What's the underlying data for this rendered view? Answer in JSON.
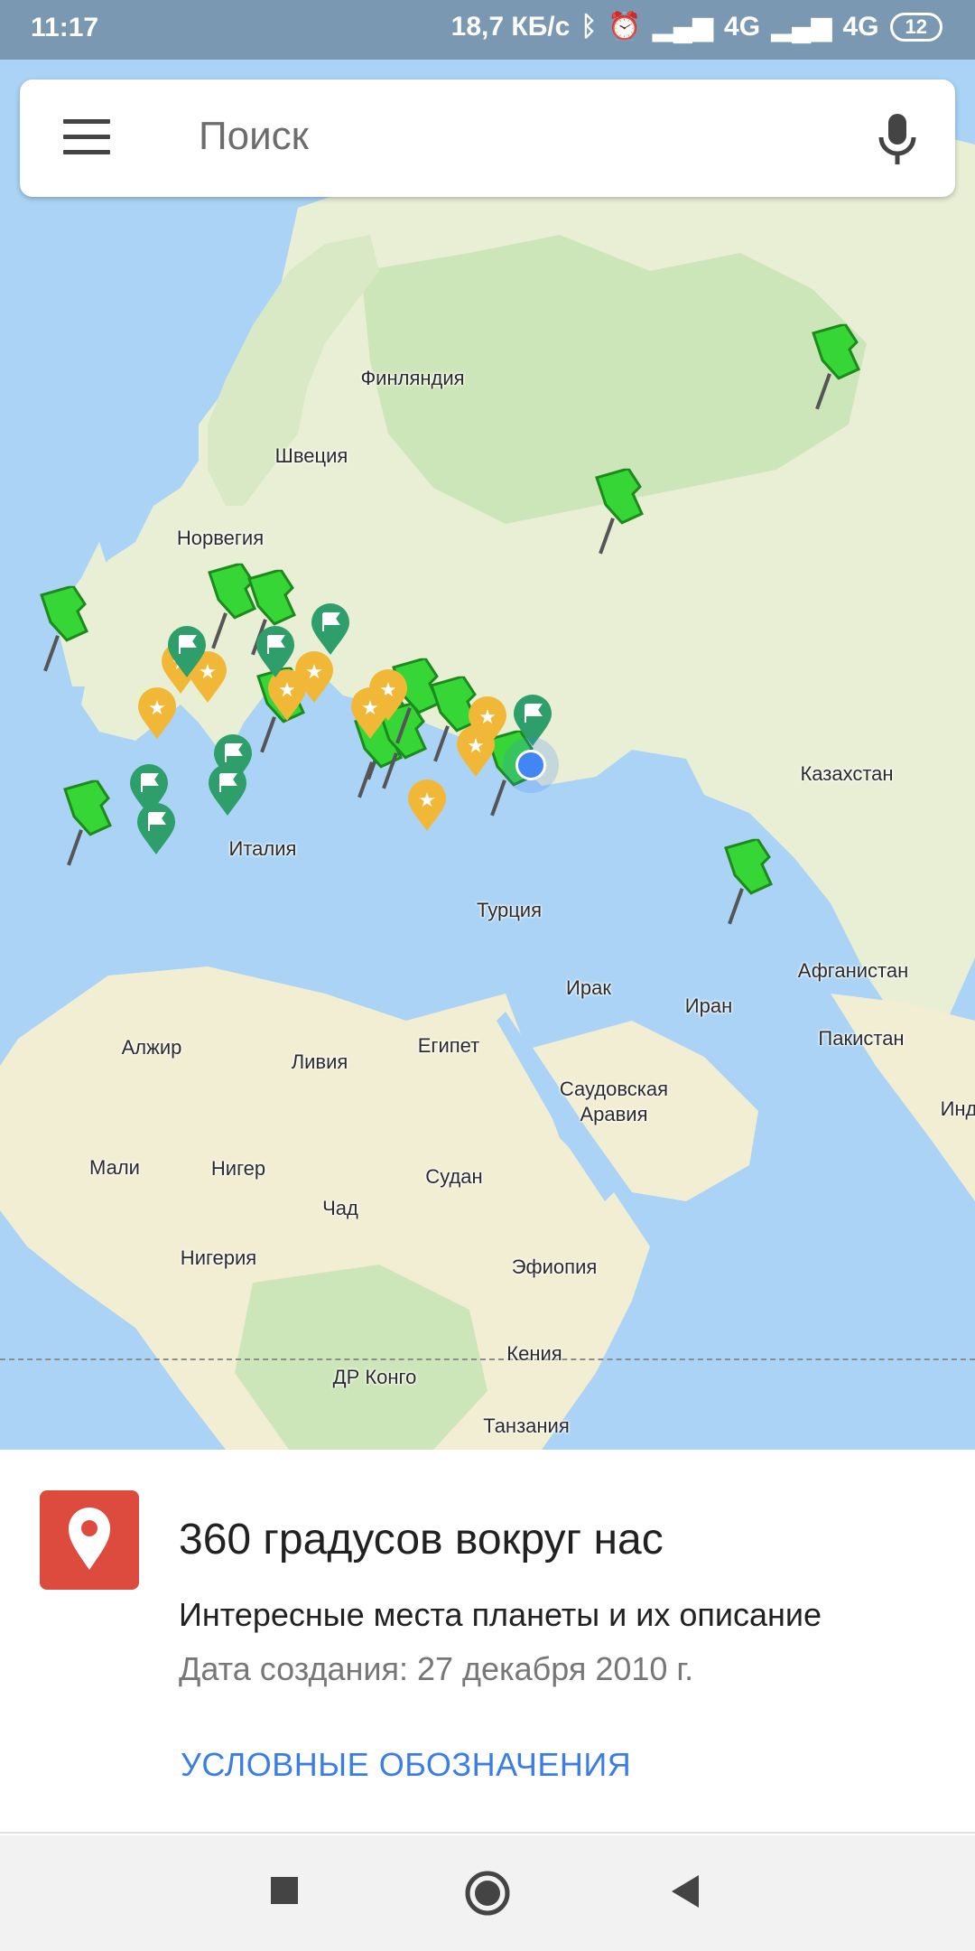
{
  "status_bar": {
    "time": "11:17",
    "speed": "18,7 КБ/с",
    "network1": "4G",
    "network2": "4G",
    "battery": "12"
  },
  "search": {
    "placeholder": "Поиск",
    "menu_icon": "hamburger-menu-icon",
    "mic_icon": "microphone-icon"
  },
  "map": {
    "places": [
      "Финляндия",
      "Швеция",
      "Норвегия",
      "Казахстан",
      "Италия",
      "Турция",
      "Ирак",
      "Иран",
      "Афганистан",
      "Пакистан",
      "Алжир",
      "Ливия",
      "Египет",
      "Саудовская Аравия",
      "Мали",
      "Нигер",
      "Судан",
      "Чад",
      "Нигерия",
      "Эфиопия",
      "Кения",
      "ДР Конго",
      "Танзания",
      "Инд"
    ],
    "colors": {
      "water": "#aad3f5",
      "land": "#e9efd5",
      "forest": "#cde6b9",
      "green_pin": "#2ecc40",
      "yellow_pin": "#f1b837",
      "teal_pin": "#2e9e6b",
      "my_location": "#4285f4"
    }
  },
  "panel": {
    "icon": "map-pin-logo-icon",
    "title": "360 градусов вокруг нас",
    "subtitle": "Интересные места планеты и их описание",
    "date": "Дата создания: 27 декабря 2010 г.",
    "legend_link": "УСЛОВНЫЕ ОБОЗНАЧЕНИЯ"
  },
  "nav": {
    "recent_icon": "square-recents-icon",
    "home_icon": "circle-home-icon",
    "back_icon": "triangle-back-icon"
  }
}
